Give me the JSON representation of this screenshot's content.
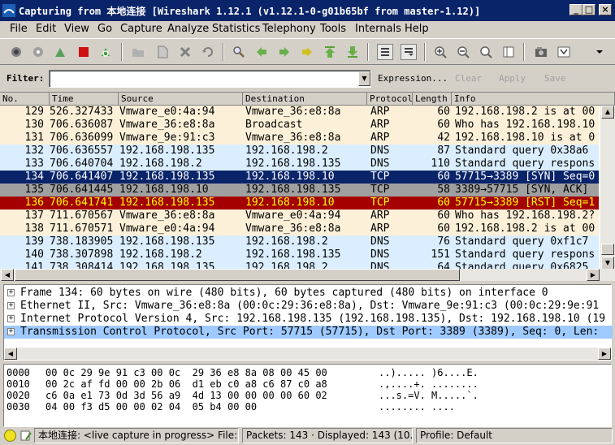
{
  "window": {
    "title": "Capturing from 本地连接   [Wireshark 1.12.1  (v1.12.1-0-g01b65bf from master-1.12)]",
    "minimize_label": "_",
    "maximize_label": "□",
    "close_label": "×"
  },
  "menu": [
    "File",
    "Edit",
    "View",
    "Go",
    "Capture",
    "Analyze",
    "Statistics",
    "Telephony",
    "Tools",
    "Internals",
    "Help"
  ],
  "filter": {
    "label": "Filter:",
    "value": "",
    "expression": "Expression...",
    "clear": "Clear",
    "apply": "Apply",
    "save": "Save"
  },
  "columns": [
    "No.",
    "Time",
    "Source",
    "Destination",
    "Protocol",
    "Length",
    "Info"
  ],
  "packets": [
    {
      "no": "129",
      "time": "526.327433",
      "src": "Vmware_e0:4a:94",
      "dst": "Vmware_36:e8:8a",
      "proto": "ARP",
      "len": "60",
      "info": "192.168.198.2 is at 00"
    },
    {
      "no": "130",
      "time": "706.636087",
      "src": "Vmware_36:e8:8a",
      "dst": "Broadcast",
      "proto": "ARP",
      "len": "60",
      "info": "Who has 192.168.198.10"
    },
    {
      "no": "131",
      "time": "706.636099",
      "src": "Vmware_9e:91:c3",
      "dst": "Vmware_36:e8:8a",
      "proto": "ARP",
      "len": "42",
      "info": "192.168.198.10 is at 0"
    },
    {
      "no": "132",
      "time": "706.636557",
      "src": "192.168.198.135",
      "dst": "192.168.198.2",
      "proto": "DNS",
      "len": "87",
      "info": "Standard query 0x38a6"
    },
    {
      "no": "133",
      "time": "706.640704",
      "src": "192.168.198.2",
      "dst": "192.168.198.135",
      "proto": "DNS",
      "len": "110",
      "info": "Standard query respons"
    },
    {
      "no": "134",
      "time": "706.641407",
      "src": "192.168.198.135",
      "dst": "192.168.198.10",
      "proto": "TCP",
      "len": "60",
      "info": "57715→3389 [SYN] Seq=0"
    },
    {
      "no": "135",
      "time": "706.641445",
      "src": "192.168.198.10",
      "dst": "192.168.198.135",
      "proto": "TCP",
      "len": "58",
      "info": "3389→57715 [SYN, ACK]"
    },
    {
      "no": "136",
      "time": "706.641741",
      "src": "192.168.198.135",
      "dst": "192.168.198.10",
      "proto": "TCP",
      "len": "60",
      "info": "57715→3389 [RST] Seq=1"
    },
    {
      "no": "137",
      "time": "711.670567",
      "src": "Vmware_36:e8:8a",
      "dst": "Vmware_e0:4a:94",
      "proto": "ARP",
      "len": "60",
      "info": "Who has 192.168.198.2?"
    },
    {
      "no": "138",
      "time": "711.670571",
      "src": "Vmware_e0:4a:94",
      "dst": "Vmware_36:e8:8a",
      "proto": "ARP",
      "len": "60",
      "info": "192.168.198.2 is at 00"
    },
    {
      "no": "139",
      "time": "738.183905",
      "src": "192.168.198.135",
      "dst": "192.168.198.2",
      "proto": "DNS",
      "len": "76",
      "info": "Standard query 0xf1c7"
    },
    {
      "no": "140",
      "time": "738.307898",
      "src": "192.168.198.2",
      "dst": "192.168.198.135",
      "proto": "DNS",
      "len": "151",
      "info": "Standard query respons"
    },
    {
      "no": "141",
      "time": "738.308414",
      "src": "192.168.198.135",
      "dst": "192.168.198.2",
      "proto": "DNS",
      "len": "64",
      "info": "Standard query 0x6825"
    }
  ],
  "row_colors": {
    "ARP": "#fcf0d8",
    "DNS": "#daeeff",
    "selected_bg": "#0a246a",
    "syn_ack_bg": "#a0a0a0",
    "rst_bg": "#a40000",
    "rst_fg": "#ffff00"
  },
  "details": [
    "Frame 134: 60 bytes on wire (480 bits), 60 bytes captured (480 bits) on interface 0",
    "Ethernet II, Src: Vmware_36:e8:8a (00:0c:29:36:e8:8a), Dst: Vmware_9e:91:c3 (00:0c:29:9e:91",
    "Internet Protocol Version 4, Src: 192.168.198.135 (192.168.198.135), Dst: 192.168.198.10 (19",
    "Transmission Control Protocol, Src Port: 57715 (57715), Dst Port: 3389 (3389), Seq: 0, Len:"
  ],
  "bytes": [
    {
      "offset": "0000",
      "hex": "00 0c 29 9e 91 c3 00 0c  29 36 e8 8a 08 00 45 00",
      "ascii": "..)..... )6....E."
    },
    {
      "offset": "0010",
      "hex": "00 2c af fd 00 00 2b 06  d1 eb c0 a8 c6 87 c0 a8",
      "ascii": ".,....+. ........"
    },
    {
      "offset": "0020",
      "hex": "c6 0a e1 73 0d 3d 56 a9  4d 13 00 00 00 00 60 02",
      "ascii": "...s.=V. M.....`."
    },
    {
      "offset": "0030",
      "hex": "04 00 f3 d5 00 00 02 04  05 b4 00 00",
      "ascii": "........ ...."
    }
  ],
  "status": {
    "capture": "本地连接: <live capture in progress> File: ...",
    "packets": "Packets: 143 · Displayed: 143 (10...",
    "profile": "Profile: Default"
  }
}
